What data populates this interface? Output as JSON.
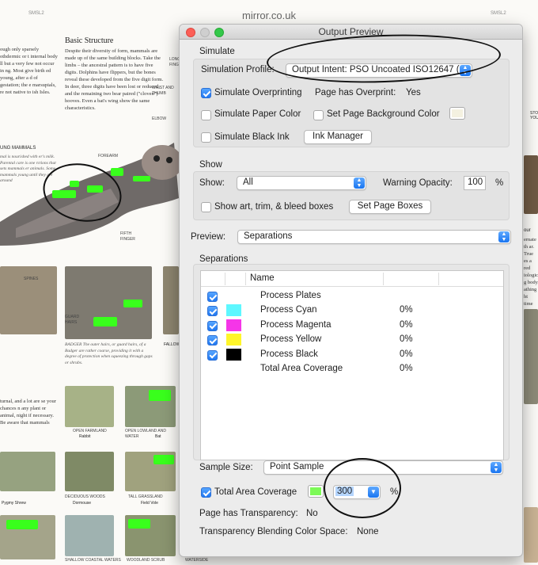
{
  "background": {
    "site": "mirror.co.uk",
    "page_left_label": "SMSL2",
    "page_right_label": "SMSL2",
    "heading": "Basic Structure",
    "body": "Despite their diversity of form, mammals are made up of the same building blocks. Take the limbs – the ancestral pattern is to have five digits. Dolphins have flippers, but the bones reveal these developed from the five digit form. In deer, three digits have been lost or reduced, and the remaining two bear paired (\"cloven\") hooves. Even a bat's wing show the same characteristics.",
    "left_col": "ough only sparsely othdermic or t internal body ll but a very few not occur in ng. Most give birth ed young, after a d of gestation; the e marsupials, re not native to ish Isles.",
    "young_heading": "UNG MAMMALS",
    "young_text": "mal is nourished with er's milk. Parental care is one rctions that sets mammals er animals. Some mammals young until they are around",
    "callouts": {
      "long_fingers": "long fingers",
      "wrist_thumb": "wrist and thumb",
      "elbow": "elbow",
      "forearm": "forearm",
      "fifth_finger": "fifth finger",
      "spines": "spines",
      "guard_hairs": "guard hairs"
    },
    "badger_caption": "BADGER The outer hairs, or guard hairs, of a Badger are rather coarse, providing it with a degree of protection when squeezing through gaps or shrubs.",
    "fallow_caption": "FALLOW",
    "lower_text": "turnal, and a lot are se your chances n any plant or animal, night if necessary. Be aware that mammals",
    "habitats": [
      "OPEN FARMLAND",
      "OPEN LOWLAND AND WATER",
      "DECIDUOUS WOODS",
      "TALL GRASSLAND",
      "SHALLOW COASTAL WATERS",
      "WOODLAND SCRUB",
      "WATERSIDE"
    ],
    "animals": [
      "Rabbit",
      "Bat",
      "Pygmy Shrew",
      "Dormouse",
      "Field Vole"
    ],
    "right_col": "STO YOU",
    "right_col2": "our",
    "right_col3": "ernate th ar. True es a red iologic g body athing ht time iving in d, which not so"
  },
  "window": {
    "title": "Output Preview",
    "simulate": {
      "section_label": "Simulate",
      "profile_label": "Simulation Profile:",
      "profile_value": "Output Intent: PSO Uncoated ISO12647 (...",
      "overprinting_label": "Simulate Overprinting",
      "overprinting_checked": true,
      "page_has_overprint_label": "Page has Overprint:",
      "page_has_overprint_value": "Yes",
      "paper_color_label": "Simulate Paper Color",
      "page_bg_label": "Set Page Background Color",
      "page_bg_color": "#f4f1e0",
      "black_ink_label": "Simulate Black Ink",
      "ink_manager_label": "Ink Manager"
    },
    "show": {
      "section_label": "Show",
      "show_label": "Show:",
      "show_value": "All",
      "warning_label": "Warning Opacity:",
      "warning_value": "100",
      "warning_unit": "%",
      "art_trim_label": "Show art, trim, & bleed boxes",
      "set_page_boxes_label": "Set Page Boxes"
    },
    "preview_label": "Preview:",
    "preview_value": "Separations",
    "separations": {
      "section_label": "Separations",
      "column_name": "Name",
      "rows": [
        {
          "name": "Process Plates",
          "value": "",
          "color": "",
          "checked": true
        },
        {
          "name": "Process Cyan",
          "value": "0%",
          "color": "#5ef7ff",
          "checked": true
        },
        {
          "name": "Process Magenta",
          "value": "0%",
          "color": "#f535e8",
          "checked": true
        },
        {
          "name": "Process Yellow",
          "value": "0%",
          "color": "#fff52a",
          "checked": true
        },
        {
          "name": "Process Black",
          "value": "0%",
          "color": "#000000",
          "checked": true
        },
        {
          "name": "Total Area Coverage",
          "value": "0%",
          "color": "",
          "checked": false
        }
      ]
    },
    "sample_size_label": "Sample Size:",
    "sample_size_value": "Point Sample",
    "tac_label": "Total Area Coverage",
    "tac_checked": true,
    "tac_color": "#7dfa57",
    "tac_value": "300",
    "tac_unit": "%",
    "transparency_label": "Page has Transparency:",
    "transparency_value": "No",
    "blend_label": "Transparency Blending Color Space:",
    "blend_value": "None"
  }
}
